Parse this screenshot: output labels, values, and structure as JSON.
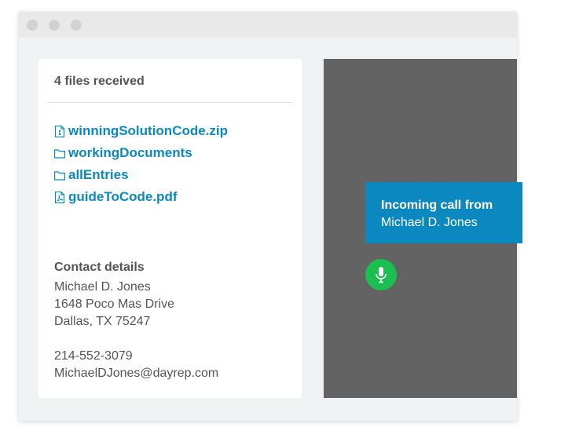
{
  "files": {
    "heading": "4 files received",
    "items": [
      {
        "name": "winningSolutionCode.zip",
        "icon": "zip-file-icon"
      },
      {
        "name": "workingDocuments",
        "icon": "folder-icon"
      },
      {
        "name": "allEntries",
        "icon": "folder-icon"
      },
      {
        "name": "guideToCode.pdf",
        "icon": "pdf-file-icon"
      }
    ]
  },
  "contact": {
    "heading": "Contact details",
    "name": "Michael D. Jones",
    "street": "1648 Poco Mas Drive",
    "city": "Dallas, TX 75247",
    "phone": "214-552-3079",
    "email": "MichaelDJones@dayrep.com"
  },
  "call": {
    "title": "Incoming call from",
    "caller": "Michael D. Jones",
    "mic_icon": "microphone-icon"
  },
  "colors": {
    "link": "#0b88bf",
    "banner": "#0b88bf",
    "mic": "#1bbf4f",
    "video_bg": "#636363"
  }
}
